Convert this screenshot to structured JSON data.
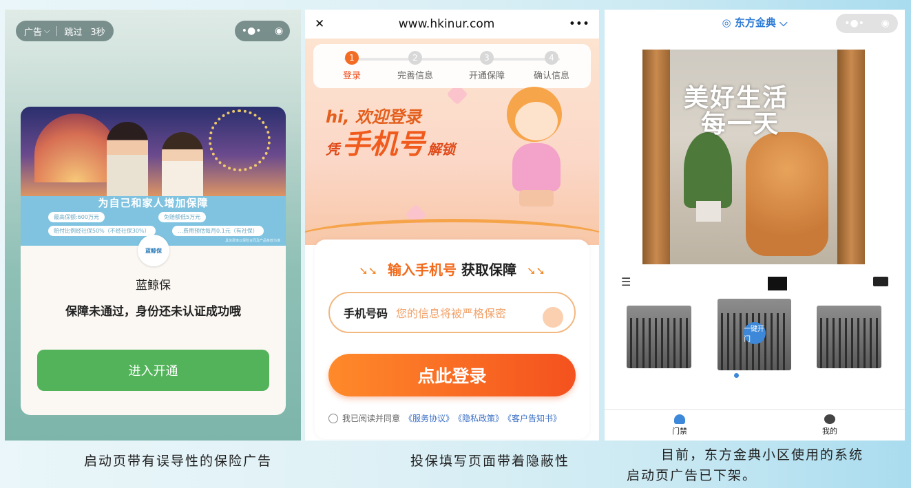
{
  "panel1": {
    "adbar": {
      "ad_label": "广告",
      "ad_chevron": "⌵",
      "skip_label": "跳过",
      "countdown": "3秒"
    },
    "capsule": {
      "more": "•●•",
      "close": "◉"
    },
    "banner": {
      "headline": "为自己和家人增加保障",
      "pills": [
        "最高保额:600万元",
        "免赔额低5万元",
        "赔付比例经社保50%（不经社保30%）",
        "…费用预估每月0.1元（有社保）"
      ],
      "fine_print": "具体费率以保险合同及产品条款为准"
    },
    "logo_text": "蓝鲸保",
    "brand_name": "蓝鲸保",
    "message": "保障未通过，身份还未认证成功哦",
    "cta_button": "进入开通"
  },
  "panel2": {
    "close_icon": "✕",
    "url": "www.hkinur.com",
    "more_icon": "•••",
    "steps": [
      {
        "num": "1",
        "label": "登录",
        "active": true
      },
      {
        "num": "2",
        "label": "完善信息",
        "active": false
      },
      {
        "num": "3",
        "label": "开通保障",
        "active": false
      },
      {
        "num": "4",
        "label": "确认信息",
        "active": false
      }
    ],
    "hero": {
      "line1": "hi, 欢迎登录",
      "line2_small_a": "凭",
      "line2_big": "手机号",
      "line2_small_b": "解锁"
    },
    "form": {
      "arrows": "➘➘",
      "title_orange": "输入手机号",
      "title_black": "获取保障",
      "field_label": "手机号码",
      "field_placeholder": "您的信息将被严格保密",
      "login_button": "点此登录",
      "agree_text": "我已阅读并同意",
      "links": [
        "《服务协议》",
        "《隐私政策》",
        "《客户告知书》"
      ]
    }
  },
  "panel3": {
    "location": "◎ 东方金典 ⌵",
    "capsule": {
      "more": "•●•",
      "close": "◉"
    },
    "slogan": [
      "美好生活",
      "每一天"
    ],
    "menu_icon": "☰",
    "unlock_button": "一键开门",
    "tabs": [
      {
        "label": "门禁",
        "active": true
      },
      {
        "label": "我的",
        "active": false
      }
    ]
  },
  "captions": {
    "c1": "启动页带有误导性的保险广告",
    "c2": "投保填写页面带着隐蔽性",
    "c3_line1": "目前，东方金典小区使用的系统",
    "c3_line2": "启动页广告已下架。"
  },
  "colors": {
    "orange": "#f36c24",
    "green": "#52b35a",
    "blue": "#3d88d8"
  }
}
